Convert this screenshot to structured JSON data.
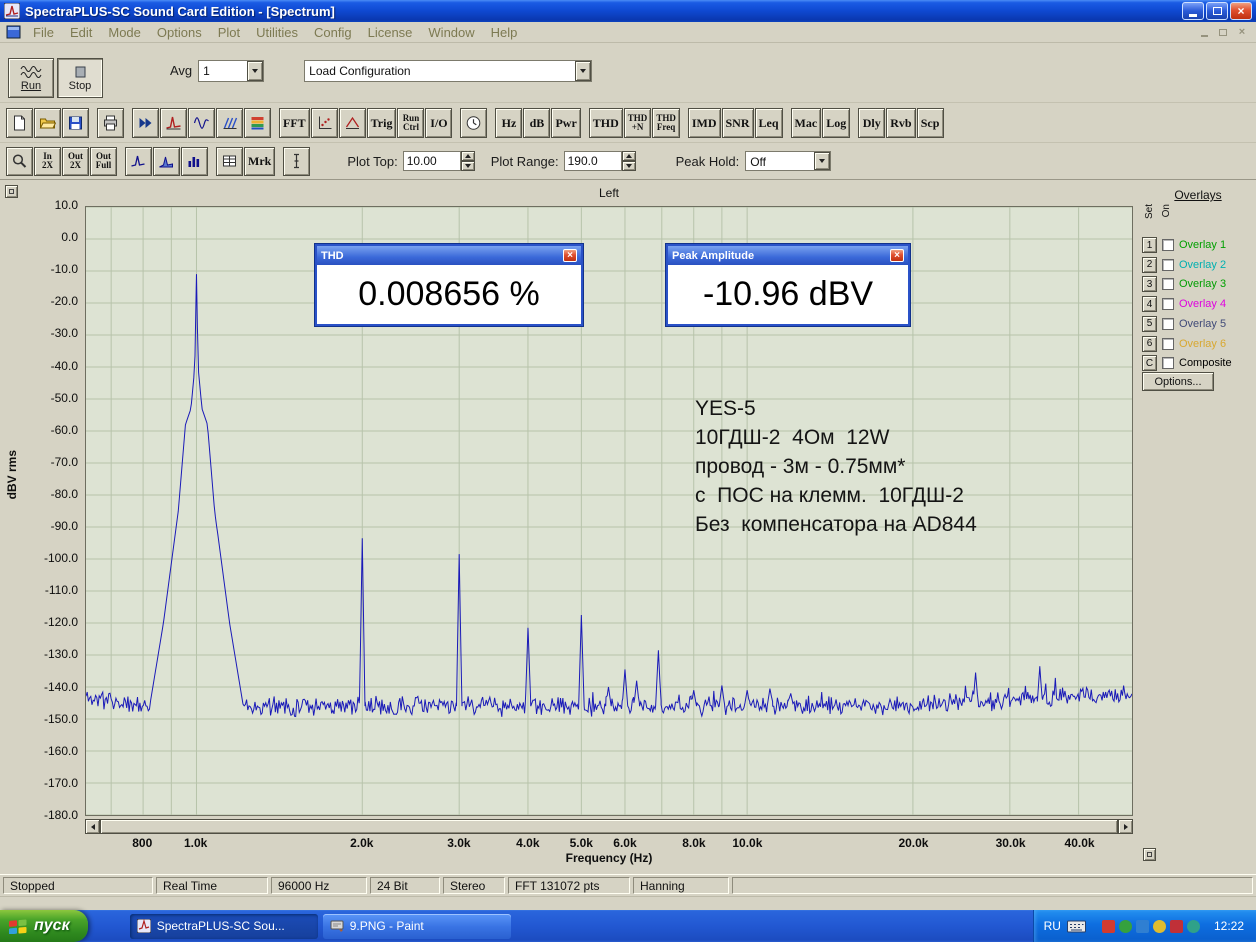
{
  "window": {
    "title": "SpectraPLUS-SC Sound Card Edition - [Spectrum]"
  },
  "menu": {
    "items": [
      "File",
      "Edit",
      "Mode",
      "Options",
      "Plot",
      "Utilities",
      "Config",
      "License",
      "Window",
      "Help"
    ]
  },
  "toolbar1": {
    "run_label": "Run",
    "stop_label": "Stop",
    "avg_label": "Avg",
    "avg_value": "1",
    "config_value": "Load Configuration"
  },
  "toolbar2": {
    "groups": [
      [
        {
          "name": "new-file",
          "icon": "new-file"
        },
        {
          "name": "open-file",
          "icon": "open-folder"
        },
        {
          "name": "save-file",
          "icon": "save"
        }
      ],
      [
        {
          "name": "print",
          "icon": "printer"
        }
      ],
      [
        {
          "name": "fast-forward",
          "icon": "ffwd"
        },
        {
          "name": "spectrum-display",
          "icon": "spectrum"
        },
        {
          "name": "time-series-display",
          "icon": "waveform"
        },
        {
          "name": "surface-display",
          "icon": "surface"
        },
        {
          "name": "spectrogram-display",
          "icon": "spectrogram"
        }
      ],
      [
        {
          "name": "fft-settings",
          "label": "FFT"
        },
        {
          "name": "scaling",
          "icon": "scale"
        },
        {
          "name": "phase-display",
          "icon": "phase"
        },
        {
          "name": "trigger",
          "label": "Trig"
        },
        {
          "name": "run-control",
          "lines": [
            "Run",
            "Ctrl"
          ]
        },
        {
          "name": "io-device",
          "label": "I/O"
        }
      ],
      [
        {
          "name": "timer",
          "icon": "clock"
        }
      ],
      [
        {
          "name": "hz-units",
          "label": "Hz"
        },
        {
          "name": "db-units",
          "label": "dB"
        },
        {
          "name": "power-units",
          "label": "Pwr"
        }
      ],
      [
        {
          "name": "thd",
          "label": "THD"
        },
        {
          "name": "thd-n",
          "lines": [
            "THD",
            "+N"
          ]
        },
        {
          "name": "thd-freq",
          "lines": [
            "THD",
            "Freq"
          ]
        }
      ],
      [
        {
          "name": "imd",
          "label": "IMD"
        },
        {
          "name": "snr",
          "label": "SNR"
        },
        {
          "name": "leq",
          "label": "Leq"
        }
      ],
      [
        {
          "name": "mac",
          "label": "Mac"
        },
        {
          "name": "log",
          "label": "Log"
        }
      ],
      [
        {
          "name": "delay",
          "label": "Dly"
        },
        {
          "name": "reverb",
          "label": "Rvb"
        },
        {
          "name": "scope",
          "label": "Scp"
        }
      ]
    ]
  },
  "toolbar3": {
    "groups": [
      [
        {
          "name": "zoom",
          "icon": "magnifier"
        },
        {
          "name": "zoom-in-2x",
          "lines": [
            "In",
            "2X"
          ]
        },
        {
          "name": "zoom-out-2x",
          "lines": [
            "Out",
            "2X"
          ]
        },
        {
          "name": "zoom-out-full",
          "lines": [
            "Out",
            "Full"
          ]
        }
      ],
      [
        {
          "name": "peak-display",
          "icon": "peak-trace"
        },
        {
          "name": "filled-display",
          "icon": "filled-trace"
        },
        {
          "name": "bar-display",
          "icon": "bar-chart"
        }
      ],
      [
        {
          "name": "data-table",
          "icon": "table"
        },
        {
          "name": "markers",
          "label": "Mrk"
        }
      ],
      [
        {
          "name": "vertical-scale",
          "icon": "v-scale"
        }
      ]
    ],
    "plot_top_label": "Plot Top:",
    "plot_top_value": "10.00",
    "plot_range_label": "Plot Range:",
    "plot_range_value": "190.0",
    "peak_hold_label": "Peak Hold:",
    "peak_hold_value": "Off"
  },
  "plot": {
    "title": "Left",
    "ylabel": "dBV rms",
    "xlabel": "Frequency (Hz)",
    "logo_main": "S",
    "logo_plus": "+"
  },
  "panels": {
    "thd": {
      "title": "THD",
      "value": "0.008656 %"
    },
    "peak": {
      "title": "Peak Amplitude",
      "value": "-10.96 dBV"
    }
  },
  "annotation": {
    "lines": [
      "YES-5",
      "10ГДШ-2  4Ом  12W",
      "провод - 3м - 0.75мм*",
      "с  ПОС на клемм.  10ГДШ-2",
      "Без  компенсатора на AD844"
    ]
  },
  "overlays": {
    "title": "Overlays",
    "set_label": "Set",
    "on_label": "On",
    "options_label": "Options...",
    "items": [
      {
        "btn": "1",
        "label": "Overlay 1",
        "color": "#00a000",
        "checked": false
      },
      {
        "btn": "2",
        "label": "Overlay 2",
        "color": "#00b0b0",
        "checked": false
      },
      {
        "btn": "3",
        "label": "Overlay 3",
        "color": "#00a000",
        "checked": false
      },
      {
        "btn": "4",
        "label": "Overlay 4",
        "color": "#e000e0",
        "checked": false
      },
      {
        "btn": "5",
        "label": "Overlay 5",
        "color": "#404a78",
        "checked": false
      },
      {
        "btn": "6",
        "label": "Overlay 6",
        "color": "#d8a830",
        "checked": false
      },
      {
        "btn": "C",
        "label": "Composite",
        "color": "#000000",
        "checked": false
      }
    ]
  },
  "statusbar": {
    "cells": [
      "Stopped",
      "Real Time",
      "96000 Hz",
      "24 Bit",
      "Stereo",
      "FFT 131072 pts",
      "Hanning"
    ]
  },
  "taskbar": {
    "start": "пуск",
    "tasks": [
      {
        "label": "SpectraPLUS-SC Sou...",
        "icon": "spectra-task",
        "active": true
      },
      {
        "label": "9.PNG - Paint",
        "icon": "paint-task",
        "active": false
      }
    ],
    "lang": "RU",
    "time": "12:22",
    "tray_icon_colors": [
      "#d23b2f",
      "#35a13e",
      "#2f7fd2",
      "#e0bc2e",
      "#c03038",
      "#2fa189"
    ]
  },
  "colors": {
    "trace": "#1a1ab8",
    "plot_bg": "#dde3d3",
    "grid": "#b7c3aa",
    "titlebar_blue": "#0f49d2",
    "taskbar_blue": "#2258d2",
    "start_green": "#2f8a1f"
  },
  "chart_data": {
    "type": "line",
    "title": "Left",
    "xlabel": "Frequency (Hz)",
    "ylabel": "dBV rms",
    "x_scale": "log",
    "xlim": [
      630,
      50000
    ],
    "ylim": [
      -180,
      10
    ],
    "y_tick_step": 10,
    "x_ticks": [
      {
        "f": 800,
        "label": "800"
      },
      {
        "f": 1000,
        "label": "1.0k"
      },
      {
        "f": 2000,
        "label": "2.0k"
      },
      {
        "f": 3000,
        "label": "3.0k"
      },
      {
        "f": 4000,
        "label": "4.0k"
      },
      {
        "f": 5000,
        "label": "5.0k"
      },
      {
        "f": 6000,
        "label": "6.0k"
      },
      {
        "f": 8000,
        "label": "8.0k"
      },
      {
        "f": 10000,
        "label": "10.0k"
      },
      {
        "f": 20000,
        "label": "20.0k"
      },
      {
        "f": 30000,
        "label": "30.0k"
      },
      {
        "f": 40000,
        "label": "40.0k"
      }
    ],
    "trace_color": "#1a1ab8",
    "noise_floor_dbv": -146,
    "fundamental": {
      "f": 1000,
      "db": -11,
      "skirt": [
        [
          0,
          -11
        ],
        [
          0.003,
          -40
        ],
        [
          0.01,
          -53
        ],
        [
          0.02,
          -58
        ],
        [
          0.033,
          -85
        ],
        [
          0.06,
          -120
        ],
        [
          0.085,
          -146
        ]
      ]
    },
    "harmonics": [
      {
        "f": 2000,
        "db": -93.5
      },
      {
        "f": 3000,
        "db": -98.5
      },
      {
        "f": 4000,
        "db": -121.5
      },
      {
        "f": 5000,
        "db": -117.5
      },
      {
        "f": 5600,
        "db": -140
      },
      {
        "f": 6000,
        "db": -134.5
      },
      {
        "f": 6300,
        "db": -138
      },
      {
        "f": 6900,
        "db": -128.5
      },
      {
        "f": 8000,
        "db": -141
      },
      {
        "f": 9000,
        "db": -139.5
      },
      {
        "f": 10000,
        "db": -141
      },
      {
        "f": 11000,
        "db": -140.5
      },
      {
        "f": 12000,
        "db": -142
      },
      {
        "f": 26000,
        "db": -135.5
      },
      {
        "f": 34000,
        "db": -133.5
      }
    ],
    "measurements": {
      "thd": "0.008656 %",
      "peak_amplitude": "-10.96 dBV"
    }
  }
}
